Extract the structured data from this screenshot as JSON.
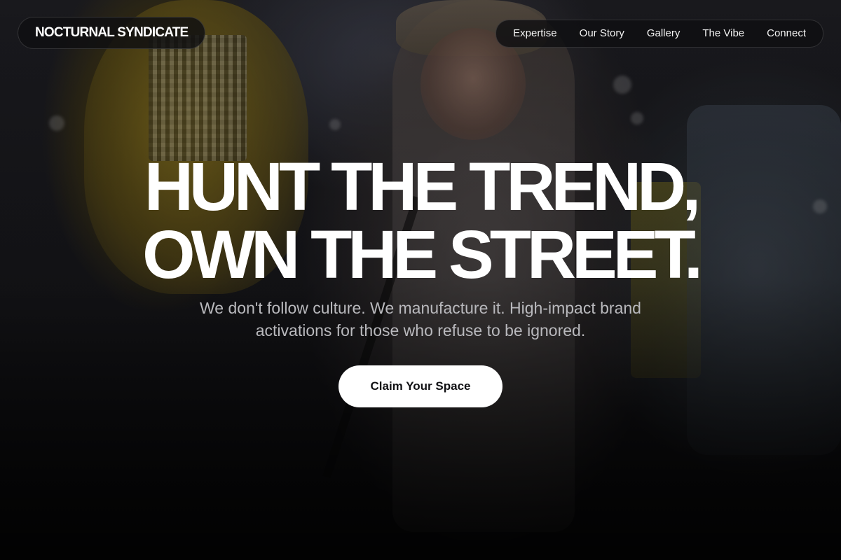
{
  "brand": {
    "logo_text": "NOCTURNAL SYNDICATE"
  },
  "nav": {
    "items": [
      {
        "label": "Expertise"
      },
      {
        "label": "Our Story"
      },
      {
        "label": "Gallery"
      },
      {
        "label": "The Vibe"
      },
      {
        "label": "Connect"
      }
    ]
  },
  "hero": {
    "headline_line1": "HUNT THE TREND,",
    "headline_line2": "OWN THE STREET.",
    "subtitle": "We don't follow culture. We manufacture it. High-impact brand activations for those who refuse to be ignored.",
    "cta_label": "Claim Your Space"
  },
  "colors": {
    "text_primary": "#ffffff",
    "text_muted": "#b9b9bd",
    "pill_background": "#0f0f11",
    "cta_background": "#ffffff",
    "cta_text": "#111114"
  }
}
